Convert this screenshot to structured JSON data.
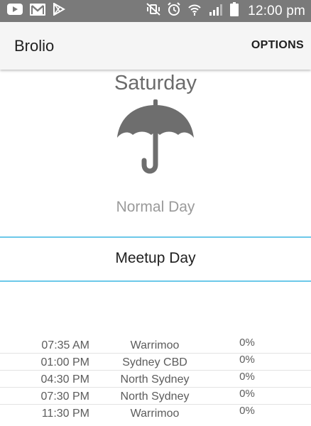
{
  "status_bar": {
    "left_icons": [
      "youtube-icon",
      "gmail-icon",
      "play-store-icon"
    ],
    "right_icons": [
      "vibrate-mute-icon",
      "alarm-icon",
      "wifi-icon",
      "signal-icon",
      "battery-icon"
    ],
    "time": "12:00 pm"
  },
  "app_bar": {
    "title": "Brolio",
    "options_label": "OPTIONS"
  },
  "weather": {
    "day": "Saturday",
    "icon": "umbrella-icon",
    "day_type": "Normal Day"
  },
  "meetup": {
    "label": "Meetup Day",
    "accent_color": "#6cc8e9"
  },
  "schedule": [
    {
      "time": "07:35 AM",
      "place": "Warrimoo",
      "chance": "0%"
    },
    {
      "time": "01:00 PM",
      "place": "Sydney CBD",
      "chance": "0%"
    },
    {
      "time": "04:30 PM",
      "place": "North Sydney",
      "chance": "0%"
    },
    {
      "time": "07:30 PM",
      "place": "North Sydney",
      "chance": "0%"
    },
    {
      "time": "11:30 PM",
      "place": "Warrimoo",
      "chance": "0%"
    }
  ]
}
